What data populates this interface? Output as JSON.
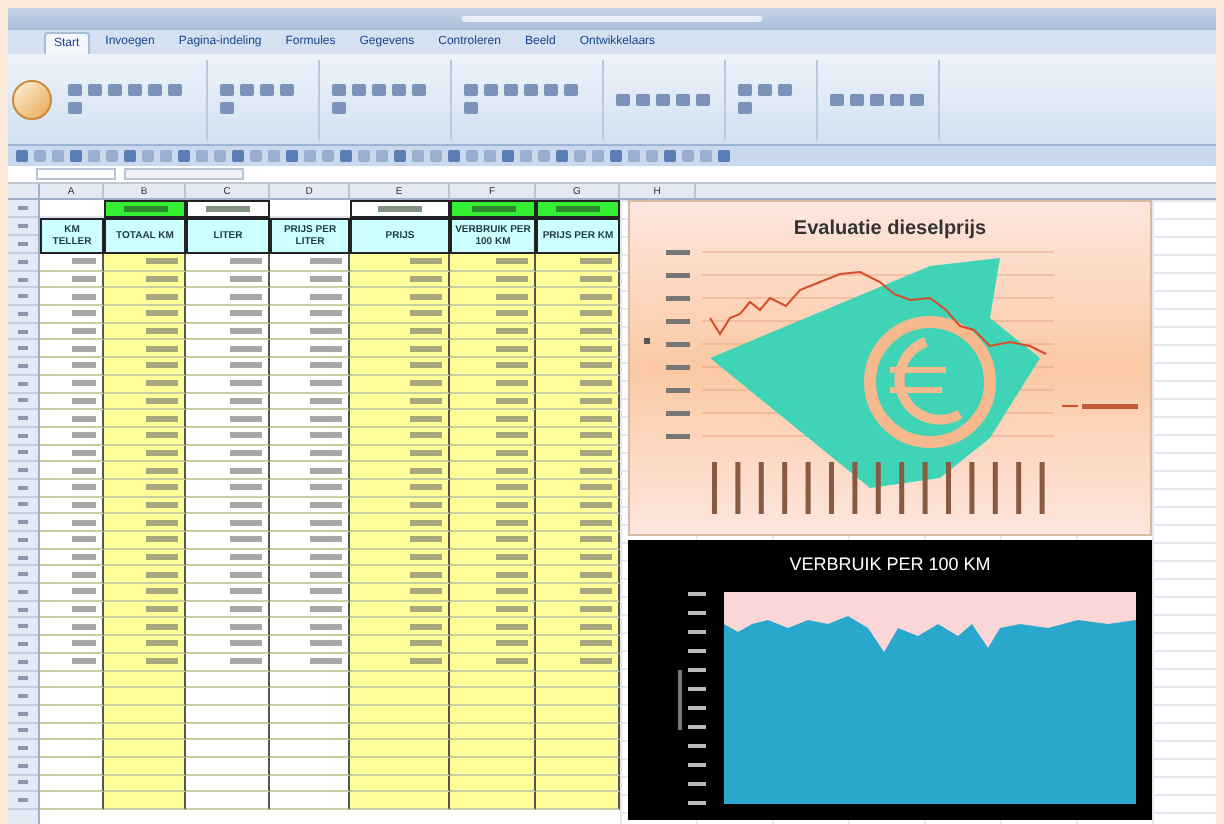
{
  "tabs": [
    {
      "label": "Start",
      "selected": true
    },
    {
      "label": "Invoegen",
      "selected": false
    },
    {
      "label": "Pagina-indeling",
      "selected": false
    },
    {
      "label": "Formules",
      "selected": false
    },
    {
      "label": "Gegevens",
      "selected": false
    },
    {
      "label": "Controleren",
      "selected": false
    },
    {
      "label": "Beeld",
      "selected": false
    },
    {
      "label": "Ontwikkelaars",
      "selected": false
    }
  ],
  "sheet": {
    "column_letters": [
      "A",
      "B",
      "C",
      "D",
      "E",
      "F",
      "G",
      "H"
    ],
    "columns": [
      {
        "header": "KM TELLER",
        "highlighted": false
      },
      {
        "header": "TOTAAL KM",
        "highlighted": true,
        "total": {
          "highlighted": true
        }
      },
      {
        "header": "LITER",
        "highlighted": false,
        "total": {
          "highlighted": false
        }
      },
      {
        "header": "PRIJS PER LITER",
        "highlighted": false
      },
      {
        "header": "PRIJS",
        "highlighted": true,
        "total": {
          "highlighted": false
        }
      },
      {
        "header": "VERBRUIK PER 100 KM",
        "highlighted": true,
        "total": {
          "highlighted": true
        }
      },
      {
        "header": "PRIJS PER KM",
        "highlighted": true,
        "total": {
          "highlighted": true
        }
      }
    ],
    "rows": [
      {
        "kind": "filled"
      },
      {
        "kind": "filled"
      },
      {
        "kind": "filled"
      },
      {
        "kind": "filled"
      },
      {
        "kind": "filled"
      },
      {
        "kind": "filled"
      },
      {
        "kind": "filled"
      },
      {
        "kind": "filled"
      },
      {
        "kind": "filled"
      },
      {
        "kind": "filled"
      },
      {
        "kind": "filled"
      },
      {
        "kind": "filled"
      },
      {
        "kind": "filled"
      },
      {
        "kind": "filled"
      },
      {
        "kind": "filled"
      },
      {
        "kind": "filled"
      },
      {
        "kind": "filled"
      },
      {
        "kind": "filled"
      },
      {
        "kind": "filled"
      },
      {
        "kind": "filled"
      },
      {
        "kind": "filled"
      },
      {
        "kind": "filled"
      },
      {
        "kind": "filled"
      },
      {
        "kind": "filled"
      },
      {
        "kind": "empty"
      },
      {
        "kind": "empty"
      },
      {
        "kind": "empty"
      },
      {
        "kind": "empty"
      },
      {
        "kind": "empty"
      },
      {
        "kind": "empty"
      },
      {
        "kind": "empty"
      },
      {
        "kind": "empty"
      }
    ]
  },
  "price_chart": {
    "title": "Evaluatie dieselprijs"
  },
  "consumption_chart": {
    "title": "VERBRUIK PER 100 KM"
  }
}
